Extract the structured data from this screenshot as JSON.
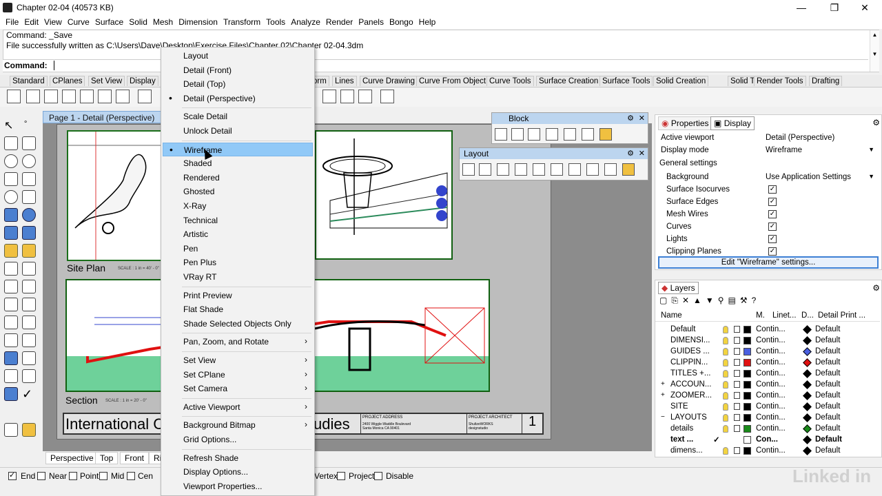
{
  "window": {
    "title": "Chapter 02-04 (40573 KB)"
  },
  "menubar": [
    "File",
    "Edit",
    "View",
    "Curve",
    "Surface",
    "Solid",
    "Mesh",
    "Dimension",
    "Transform",
    "Tools",
    "Analyze",
    "Render",
    "Panels",
    "Bongo",
    "Help"
  ],
  "command_history": [
    "Command: _Save",
    "File successfully written as C:\\Users\\Dave\\Desktop\\Exercise Files\\Chapter 02\\Chapter 02-04.3dm"
  ],
  "command_prompt": "Command:",
  "toolbar_tabs": [
    "Standard",
    "CPlanes",
    "Set View",
    "Display",
    "orm",
    "Lines",
    "Curve Drawing",
    "Curve From Object",
    "Curve Tools",
    "Surface Creation",
    "Surface Tools",
    "Solid Creation",
    "Solid Tools",
    "Render Tools",
    "Drafting"
  ],
  "viewport": {
    "title": "Page 1 - Detail (Perspective)"
  },
  "layout_labels": {
    "site_plan": "Site Plan",
    "section": "Section",
    "scale1": "SCALE : 1 in = 40' - 0\"",
    "scale2": "SCALE : 1 in = 20' - 0\"",
    "title_left": "International C",
    "title_right": "udies",
    "project_address_label": "PROJECT ADDRESS",
    "project_address": "2400 Wiggle-Waddle Boulevard\nSanta Monica CA 90401",
    "project_architect_label": "PROJECT ARCHITECT",
    "project_architect": "ShultzeWORKS\ndesignstudio",
    "page_no": "1"
  },
  "viewport_tabs": [
    "Perspective",
    "Top",
    "Front",
    "Ri"
  ],
  "osnap": [
    {
      "label": "End",
      "checked": true
    },
    {
      "label": "Near",
      "checked": false
    },
    {
      "label": "Point",
      "checked": false
    },
    {
      "label": "Mid",
      "checked": false
    },
    {
      "label": "Cen",
      "checked": false
    },
    {
      "label": "Vertex",
      "checked": false
    },
    {
      "label": "Project",
      "checked": false
    },
    {
      "label": "Disable",
      "checked": false
    }
  ],
  "block_panel": {
    "title": "Block"
  },
  "layout_panel": {
    "title": "Layout"
  },
  "properties": {
    "tabs": [
      "Properties",
      "Display"
    ],
    "active_viewport_label": "Active viewport",
    "active_viewport": "Detail (Perspective)",
    "display_mode_label": "Display mode",
    "display_mode": "Wireframe",
    "general_settings": "General settings",
    "background_label": "Background",
    "background": "Use Application Settings",
    "checks": [
      "Surface Isocurves",
      "Surface Edges",
      "Mesh Wires",
      "Curves",
      "Lights",
      "Clipping Planes"
    ],
    "edit_button": "Edit \"Wireframe\" settings..."
  },
  "layers": {
    "title": "Layers",
    "headers": [
      "Name",
      "M.",
      "Linet...",
      "D...",
      "Detail Print ..."
    ],
    "rows": [
      {
        "name": "Default",
        "color": "#000000",
        "linetype": "Contin...",
        "dcolor": "#000000",
        "print": "Default",
        "exp": ""
      },
      {
        "name": "DIMENSI...",
        "color": "#000000",
        "linetype": "Contin...",
        "dcolor": "#000000",
        "print": "Default",
        "exp": ""
      },
      {
        "name": "GUIDES ...",
        "color": "#4a5fe0",
        "linetype": "Contin...",
        "dcolor": "#4a5fe0",
        "print": "Default",
        "exp": ""
      },
      {
        "name": "CLIPPIN...",
        "color": "#e01010",
        "linetype": "Contin...",
        "dcolor": "#e01010",
        "print": "Default",
        "exp": ""
      },
      {
        "name": "TITLES +...",
        "color": "#000000",
        "linetype": "Contin...",
        "dcolor": "#000000",
        "print": "Default",
        "exp": ""
      },
      {
        "name": "ACCOUN...",
        "color": "#000000",
        "linetype": "Contin...",
        "dcolor": "#000000",
        "print": "Default",
        "exp": "+"
      },
      {
        "name": "ZOOMER...",
        "color": "#000000",
        "linetype": "Contin...",
        "dcolor": "#000000",
        "print": "Default",
        "exp": "+"
      },
      {
        "name": "SITE",
        "color": "#000000",
        "linetype": "Contin...",
        "dcolor": "#000000",
        "print": "Default",
        "exp": ""
      },
      {
        "name": "LAYOUTS",
        "color": "#000000",
        "linetype": "Contin...",
        "dcolor": "#000000",
        "print": "Default",
        "exp": "−"
      },
      {
        "name": "details",
        "color": "#1a8a1a",
        "linetype": "Contin...",
        "dcolor": "#1a8a1a",
        "print": "Default",
        "exp": ""
      },
      {
        "name": "text ...",
        "color": "#ffffff",
        "linetype": "Con...",
        "dcolor": "#000000",
        "print": "Default",
        "exp": "",
        "bold": true
      },
      {
        "name": "dimens...",
        "color": "#000000",
        "linetype": "Contin...",
        "dcolor": "#000000",
        "print": "Default",
        "exp": ""
      }
    ]
  },
  "context_menu": [
    {
      "label": "Layout"
    },
    {
      "label": "Detail (Front)"
    },
    {
      "label": "Detail (Top)"
    },
    {
      "label": "Detail (Perspective)",
      "bullet": true
    },
    {
      "sep": true
    },
    {
      "label": "Scale Detail"
    },
    {
      "label": "Unlock Detail"
    },
    {
      "sep": true
    },
    {
      "label": "Wireframe",
      "bullet": true,
      "highlight": true
    },
    {
      "label": "Shaded"
    },
    {
      "label": "Rendered"
    },
    {
      "label": "Ghosted"
    },
    {
      "label": "X-Ray"
    },
    {
      "label": "Technical"
    },
    {
      "label": "Artistic"
    },
    {
      "label": "Pen"
    },
    {
      "label": "Pen Plus"
    },
    {
      "label": "VRay RT"
    },
    {
      "sep": true
    },
    {
      "label": "Print Preview"
    },
    {
      "label": "Flat Shade"
    },
    {
      "label": "Shade Selected Objects Only"
    },
    {
      "sep": true
    },
    {
      "label": "Pan, Zoom, and Rotate",
      "submenu": true
    },
    {
      "sep": true
    },
    {
      "label": "Set View",
      "submenu": true
    },
    {
      "label": "Set CPlane",
      "submenu": true
    },
    {
      "label": "Set Camera",
      "submenu": true
    },
    {
      "sep": true
    },
    {
      "label": "Active Viewport",
      "submenu": true
    },
    {
      "sep": true
    },
    {
      "label": "Background Bitmap",
      "submenu": true
    },
    {
      "label": "Grid Options..."
    },
    {
      "sep": true
    },
    {
      "label": "Refresh Shade"
    },
    {
      "label": "Display Options..."
    },
    {
      "label": "Viewport Properties..."
    }
  ],
  "watermark": "Linked in"
}
